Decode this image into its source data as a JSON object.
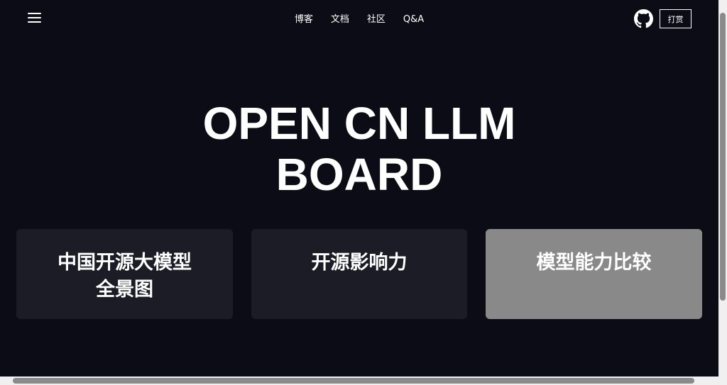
{
  "header": {
    "menu_icon": "hamburger-menu-icon",
    "nav": [
      {
        "label": "博客"
      },
      {
        "label": "文档"
      },
      {
        "label": "社区"
      },
      {
        "label": "Q&A"
      }
    ],
    "github_icon": "github-icon",
    "donate_label": "打赏"
  },
  "hero": {
    "title_line1": "OPEN CN LLM",
    "title_line2": "BOARD"
  },
  "cards": [
    {
      "line1": "中国开源大模型",
      "line2": "全景图"
    },
    {
      "line1": "开源影响力"
    },
    {
      "line1": "模型能力比较"
    }
  ],
  "colors": {
    "background": "#0b0c15",
    "card": "#1b1c25",
    "card_active": "#898989",
    "text": "#ffffff"
  }
}
